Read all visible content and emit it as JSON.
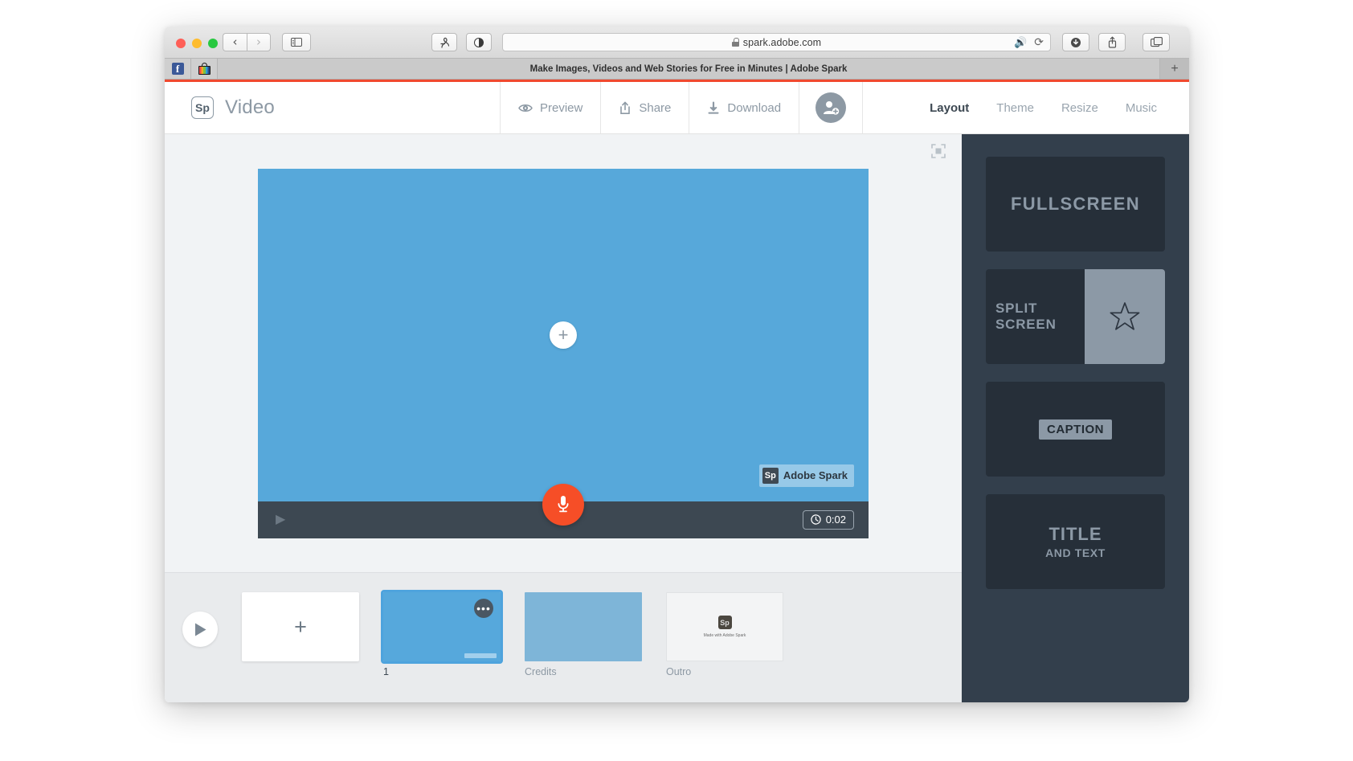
{
  "browser": {
    "url": "spark.adobe.com",
    "lock_icon": "lock-icon",
    "tab_title": "Make Images, Videos and Web Stories for Free in Minutes | Adobe Spark",
    "back_icon": "‹",
    "forward_icon": "›",
    "speaker_icon": "🔊",
    "reload_icon": "⟳",
    "newtab_icon": "+",
    "facebook_label": "f",
    "accent_color": "#f0492f"
  },
  "header": {
    "logo_text": "Sp",
    "title": "Video",
    "actions": [
      {
        "label": "Preview",
        "icon": "eye-icon"
      },
      {
        "label": "Share",
        "icon": "share-icon"
      },
      {
        "label": "Download",
        "icon": "download-icon"
      }
    ],
    "avatar_icon": "add-person-icon",
    "menu": [
      {
        "label": "Layout",
        "active": true
      },
      {
        "label": "Theme",
        "active": false
      },
      {
        "label": "Resize",
        "active": false
      },
      {
        "label": "Music",
        "active": false
      }
    ]
  },
  "stage": {
    "expand_icon": "fullscreen-icon",
    "add_media_icon": "+",
    "canvas_color": "#57a8da",
    "watermark": {
      "logo": "Sp",
      "text": "Adobe Spark"
    },
    "controls": {
      "play_icon": "▶",
      "record_icon": "microphone-icon",
      "clock_icon": "clock-icon",
      "time": "0:02"
    }
  },
  "timeline": {
    "play_icon": "▶",
    "add_slide_icon": "+",
    "slides": [
      {
        "label": "1",
        "type": "selected",
        "menu_icon": "•••"
      },
      {
        "label": "Credits",
        "type": "credits"
      },
      {
        "label": "Outro",
        "type": "outro",
        "logo": "Sp",
        "caption": "Made with Adobe Spark"
      }
    ]
  },
  "panel": {
    "cards": [
      {
        "id": "fullscreen",
        "label": "FULLSCREEN"
      },
      {
        "id": "split-screen",
        "label": "SPLIT\nSCREEN",
        "label_line1": "SPLIT",
        "label_line2": "SCREEN",
        "icon": "star-icon"
      },
      {
        "id": "caption",
        "label": "CAPTION"
      },
      {
        "id": "title-and-text",
        "label": "TITLE",
        "sublabel": "AND TEXT"
      }
    ],
    "background": "#333f4c",
    "card_color": "#262f39",
    "text_color": "#8c99a6"
  }
}
